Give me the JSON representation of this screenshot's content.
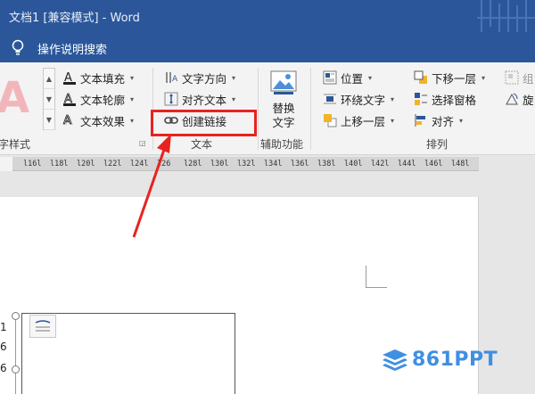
{
  "window": {
    "title": "文档1 [兼容模式]  -  Word"
  },
  "tell_me": {
    "text": "操作说明搜索"
  },
  "ribbon": {
    "wordart_group": {
      "label": "字样式",
      "fill": "文本填充",
      "outline": "文本轮廓",
      "effects": "文本效果"
    },
    "text_group": {
      "label": "文本",
      "direction": "文字方向",
      "align": "对齐文本",
      "create_link": "创建链接"
    },
    "accessibility_group": {
      "label": "辅助功能",
      "alt_text_line1": "替换",
      "alt_text_line2": "文字"
    },
    "arrange_group": {
      "label": "排列",
      "position": "位置",
      "wrap_text": "环绕文字",
      "bring_forward": "上移一层",
      "send_backward": "下移一层",
      "selection_pane": "选择窗格",
      "align": "对齐",
      "group_partial": "组",
      "rotate_partial": "旋"
    }
  },
  "ruler": {
    "ticks": [
      "l16l",
      "l18l",
      "l20l",
      "l22l",
      "l24l",
      "l26",
      "l28l",
      "l30l",
      "l32l",
      "l34l",
      "l36l",
      "l38l",
      "l40l",
      "l42l",
      "l44l",
      "l46l",
      "l48l"
    ]
  },
  "document": {
    "line_numbers": [
      "1",
      "6",
      "6"
    ]
  },
  "watermark": {
    "text": "861PPT"
  },
  "colors": {
    "accent": "#2b579a",
    "highlight": "#e8231f",
    "logo": "#3f8fe2"
  }
}
